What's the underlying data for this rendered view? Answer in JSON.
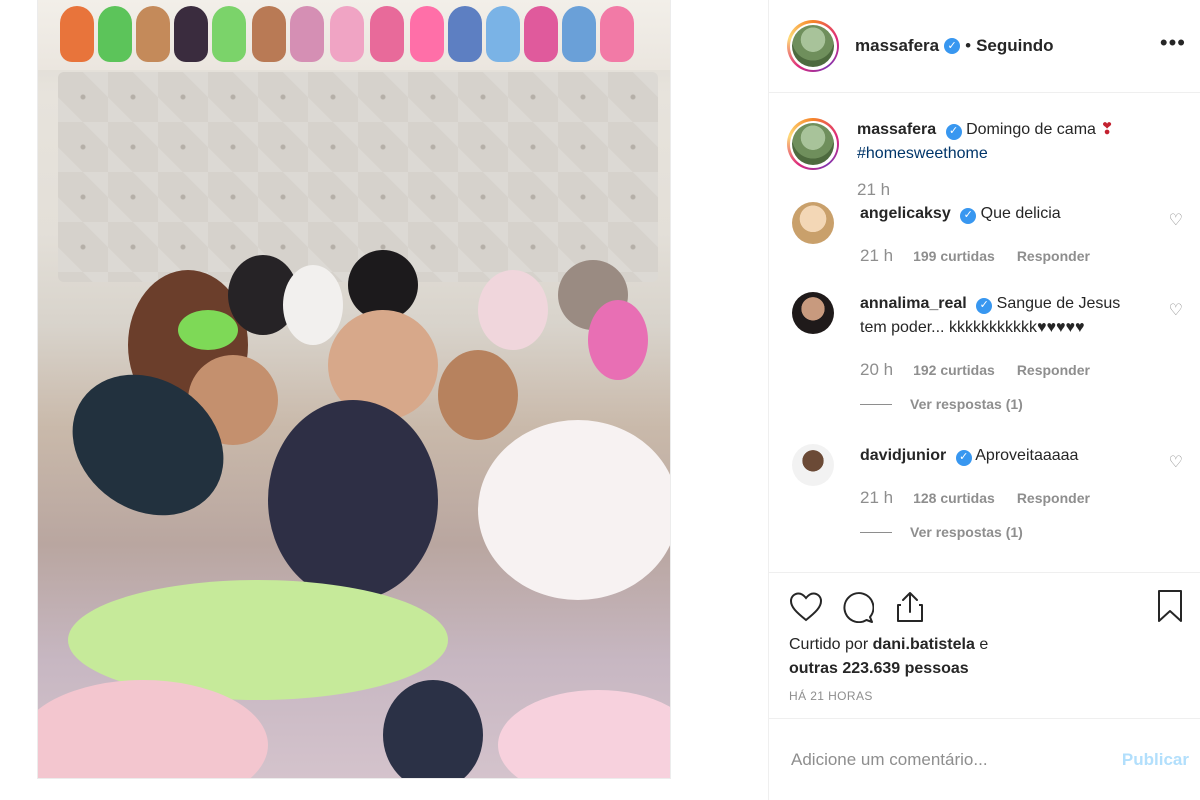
{
  "header": {
    "username": "massafera",
    "separator": "•",
    "following": "Seguindo",
    "more": "•••"
  },
  "caption": {
    "username": "massafera",
    "text": "Domingo de cama",
    "emoji": "❣",
    "hashtag": "#homesweethome",
    "time": "21 h"
  },
  "comments": [
    {
      "username": "angelicaksy",
      "text": "Que delicia",
      "time": "21 h",
      "likes": "199 curtidas",
      "reply": "Responder",
      "view_replies": ""
    },
    {
      "username": "annalima_real",
      "text": "Sangue de Jesus tem poder... kkkkkkkkkkk♥♥♥♥♥",
      "time": "20 h",
      "likes": "192 curtidas",
      "reply": "Responder",
      "view_replies": "Ver respostas (1)"
    },
    {
      "username": "davidjunior",
      "text": "Aproveitaaaaa",
      "time": "21 h",
      "likes": "128 curtidas",
      "reply": "Responder",
      "view_replies": "Ver respostas (1)"
    }
  ],
  "likes": {
    "prefix": "Curtido por",
    "user": "dani.batistela",
    "middle": "e",
    "others": "outras 223.639 pessoas"
  },
  "timestamp": "HÁ 21 HORAS",
  "add_comment": {
    "placeholder": "Adicione um comentário...",
    "publish": "Publicar"
  },
  "colors": {
    "verified": "#3897f0",
    "link": "#003569",
    "muted": "#8e8e8e",
    "publish_disabled": "#b2dffc"
  }
}
